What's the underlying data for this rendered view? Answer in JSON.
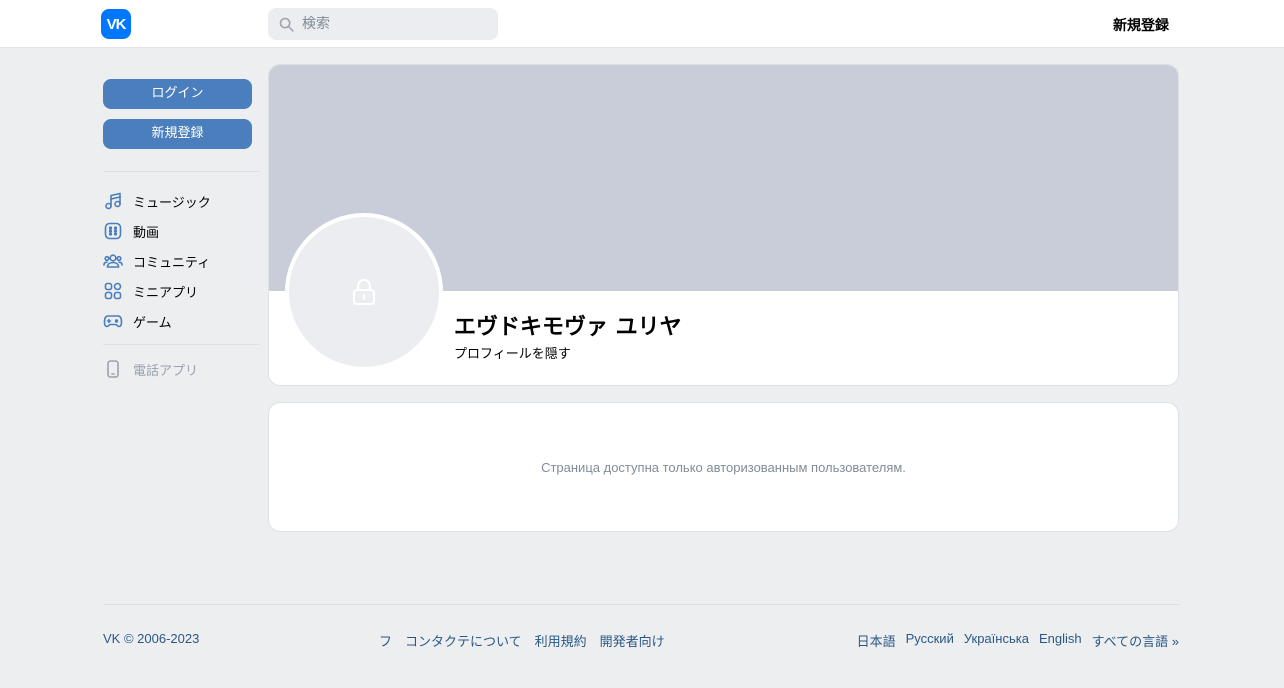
{
  "header": {
    "logo_text": "VK",
    "search_placeholder": "検索",
    "register_label": "新規登録"
  },
  "sidebar": {
    "login_button": "ログイン",
    "register_button": "新規登録",
    "menu": [
      {
        "label": "ミュージック",
        "icon": "music-icon"
      },
      {
        "label": "動画",
        "icon": "video-icon"
      },
      {
        "label": "コミュニティ",
        "icon": "community-icon"
      },
      {
        "label": "ミニアプリ",
        "icon": "mini-apps-icon"
      },
      {
        "label": "ゲーム",
        "icon": "gamepad-icon"
      }
    ],
    "phone_app": {
      "label": "電話アプリ",
      "icon": "phone-icon"
    }
  },
  "profile": {
    "name": "エヴドキモヴァ ユリヤ",
    "status": "プロフィールを隠す",
    "avatar_icon": "lock-icon"
  },
  "message": {
    "text": "Страница доступна только авторизованным пользователям."
  },
  "footer": {
    "copyright": "VK © 2006-2023",
    "links": [
      "フ",
      "コンタクテについて",
      "利用規約",
      "開発者向け"
    ],
    "languages": [
      "日本語",
      "Русский",
      "Українська",
      "English",
      "すべての言語 »"
    ]
  },
  "colors": {
    "accent": "#0077ff",
    "button": "#4a7ebd",
    "cover": "#c8cdd9",
    "link": "#2a5885",
    "background": "#edeef0"
  }
}
